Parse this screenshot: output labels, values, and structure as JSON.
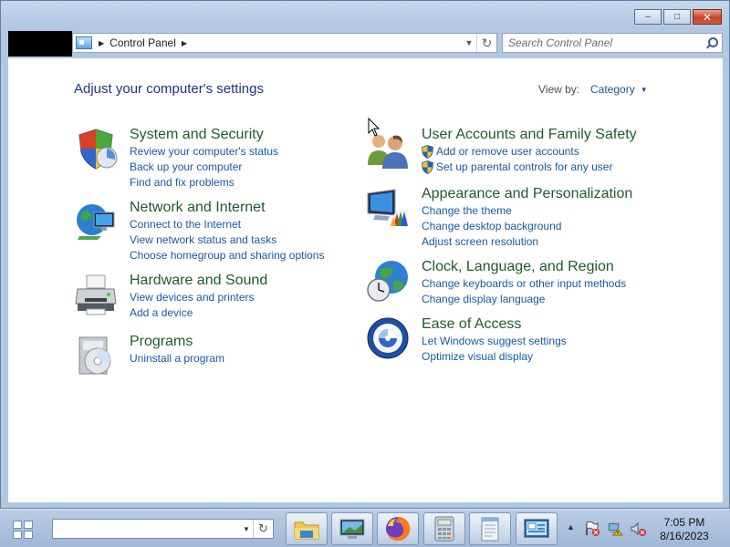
{
  "window": {
    "minimize_label": "‒",
    "maximize_label": "□",
    "close_label": "✕"
  },
  "address": {
    "crumb": "Control Panel",
    "refresh_glyph": "↻"
  },
  "search": {
    "placeholder": "Search Control Panel"
  },
  "header": {
    "title": "Adjust your computer's settings",
    "view_by_label": "View by:",
    "view_by_value": "Category"
  },
  "categories": [
    {
      "title": "System and Security",
      "icon": "system-security-shield-icon",
      "links": [
        "Review your computer's status",
        "Back up your computer",
        "Find and fix problems"
      ]
    },
    {
      "title": "Network and Internet",
      "icon": "network-globe-icon",
      "links": [
        "Connect to the Internet",
        "View network status and tasks",
        "Choose homegroup and sharing options"
      ]
    },
    {
      "title": "Hardware and Sound",
      "icon": "printer-icon",
      "links": [
        "View devices and printers",
        "Add a device"
      ]
    },
    {
      "title": "Programs",
      "icon": "programs-disc-icon",
      "links": [
        "Uninstall a program"
      ]
    },
    {
      "title": "User Accounts and Family Safety",
      "icon": "users-icon",
      "links": [
        "Add or remove user accounts",
        "Set up parental controls for any user"
      ]
    },
    {
      "title": "Appearance and Personalization",
      "icon": "monitor-palette-icon",
      "links": [
        "Change the theme",
        "Change desktop background",
        "Adjust screen resolution"
      ]
    },
    {
      "title": "Clock, Language, and Region",
      "icon": "clock-globe-icon",
      "links": [
        "Change keyboards or other input methods",
        "Change display language"
      ]
    },
    {
      "title": "Ease of Access",
      "icon": "ease-of-access-icon",
      "links": [
        "Let Windows suggest settings",
        "Optimize visual display"
      ]
    }
  ],
  "taskbar": {
    "apps": [
      "file-explorer-icon",
      "remote-desktop-icon",
      "firefox-icon",
      "calculator-icon",
      "notepad-icon",
      "control-panel-icon"
    ],
    "clock_time": "7:05 PM",
    "clock_date": "8/16/2023"
  }
}
